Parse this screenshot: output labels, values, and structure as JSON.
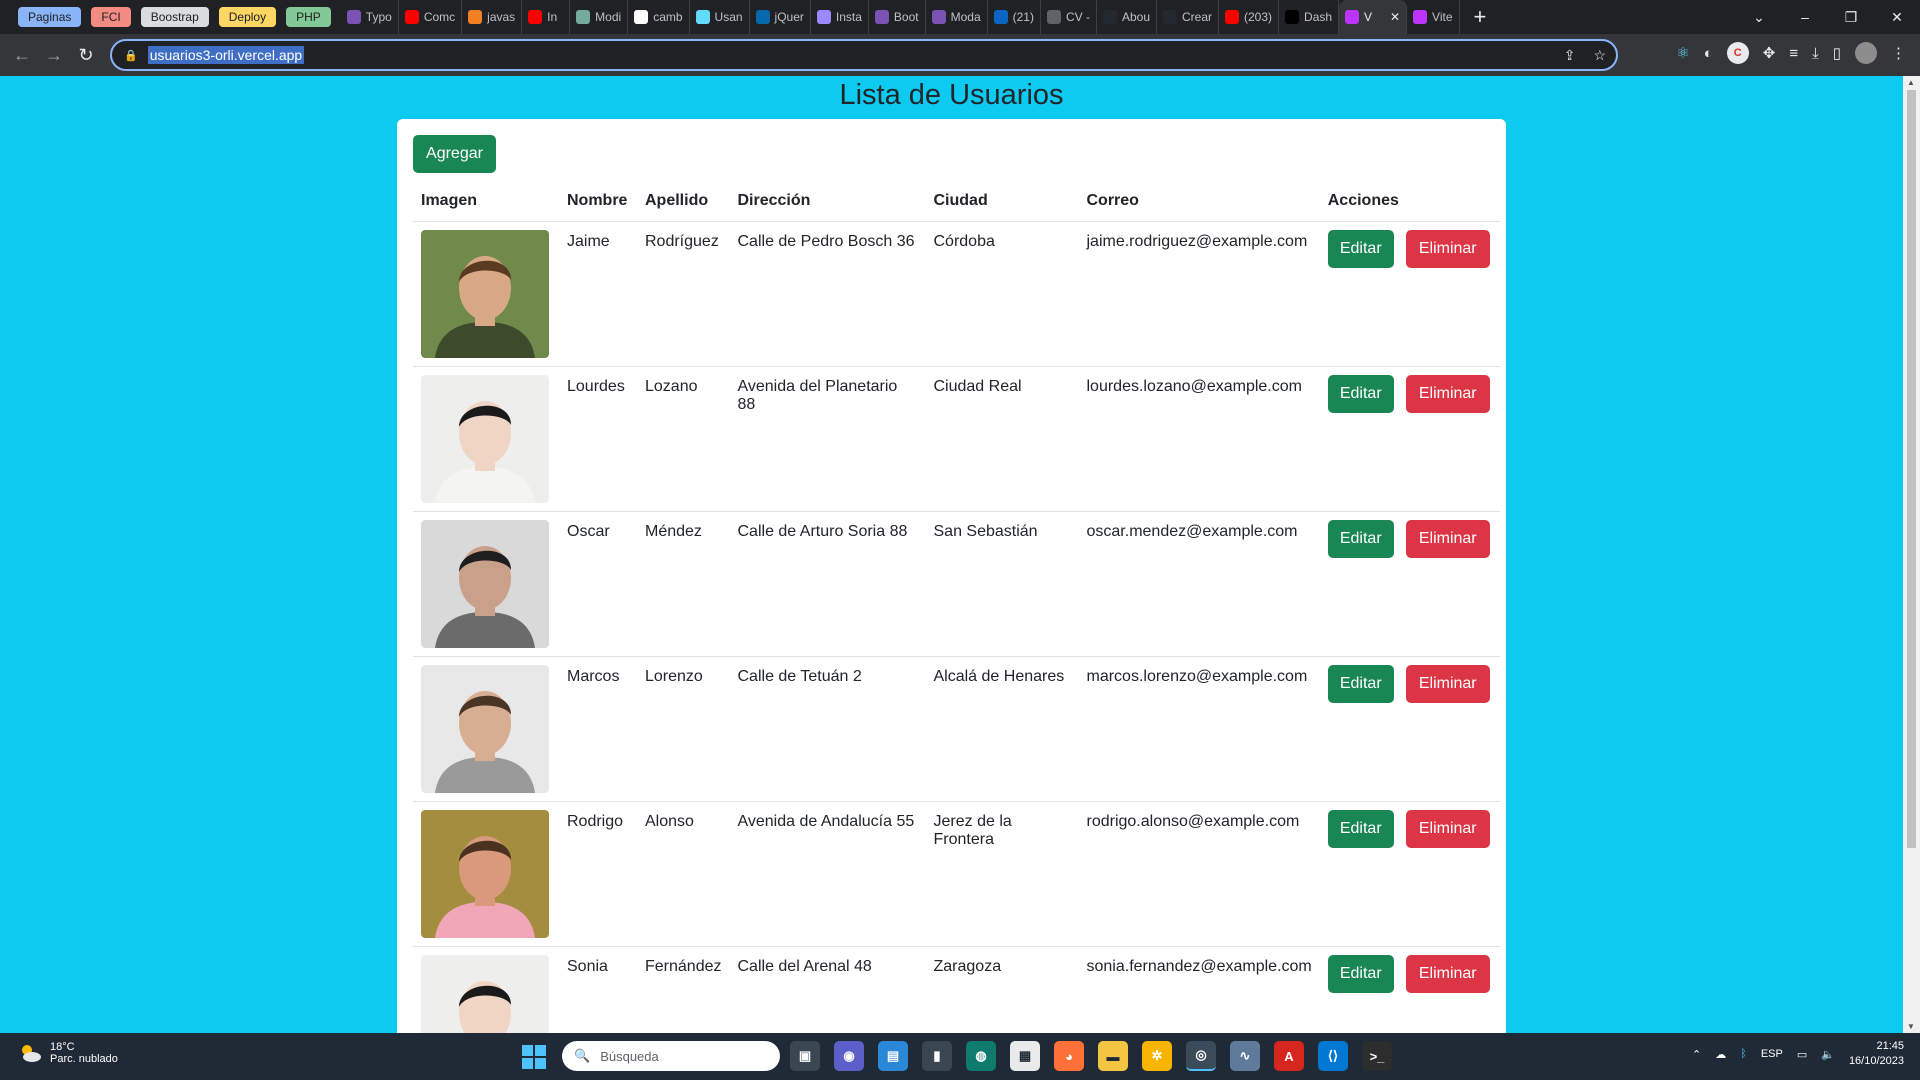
{
  "browser": {
    "bookmark_groups": [
      {
        "label": "Paginas",
        "color": "#8ab4f8"
      },
      {
        "label": "FCI",
        "color": "#f28b82"
      },
      {
        "label": "Boostrap",
        "color": "#dadce0"
      },
      {
        "label": "Deploy",
        "color": "#fdd663"
      },
      {
        "label": "PHP",
        "color": "#81c995"
      }
    ],
    "tabs": [
      {
        "label": "Typo",
        "icon": "bootstrap-icon",
        "color": "#7952b3"
      },
      {
        "label": "Comc",
        "icon": "youtube-icon",
        "color": "#ff0000"
      },
      {
        "label": "javas",
        "icon": "stackoverflow-icon",
        "color": "#f48024"
      },
      {
        "label": "In",
        "icon": "youtube-icon",
        "color": "#ff0000"
      },
      {
        "label": "Modi",
        "icon": "openai-icon",
        "color": "#74aa9c"
      },
      {
        "label": "camb",
        "icon": "google-icon",
        "color": "#ffffff"
      },
      {
        "label": "Usan",
        "icon": "react-icon",
        "color": "#61dafb"
      },
      {
        "label": "jQuer",
        "icon": "jquery-icon",
        "color": "#0769ad"
      },
      {
        "label": "Insta",
        "icon": "instagram-icon",
        "color": "#9c88ff"
      },
      {
        "label": "Boot",
        "icon": "bootstrap-icon",
        "color": "#7952b3"
      },
      {
        "label": "Moda",
        "icon": "bootstrap-icon",
        "color": "#7952b3"
      },
      {
        "label": "(21)",
        "icon": "linkedin-icon",
        "color": "#0a66c2"
      },
      {
        "label": "CV -",
        "icon": "globe-icon",
        "color": "#5f6368"
      },
      {
        "label": "Abou",
        "icon": "github-icon",
        "color": "#24292f"
      },
      {
        "label": "Crear",
        "icon": "github-icon",
        "color": "#24292f"
      },
      {
        "label": "(203)",
        "icon": "youtube-icon",
        "color": "#ff0000"
      },
      {
        "label": "Dash",
        "icon": "vercel-icon",
        "color": "#000000"
      },
      {
        "label": "V",
        "icon": "vite-icon",
        "color": "#bd34fe",
        "active": true
      },
      {
        "label": "Vite",
        "icon": "vite-icon",
        "color": "#bd34fe"
      }
    ],
    "url": "usuarios3-orli.vercel.app"
  },
  "page": {
    "title": "Lista de Usuarios",
    "add_button": "Agregar",
    "columns": [
      "Imagen",
      "Nombre",
      "Apellido",
      "Dirección",
      "Ciudad",
      "Correo",
      "Acciones"
    ],
    "edit_label": "Editar",
    "delete_label": "Eliminar",
    "users": [
      {
        "nombre": "Jaime",
        "apellido": "Rodríguez",
        "direccion": "Calle de Pedro Bosch 36",
        "ciudad": "Córdoba",
        "correo": "jaime.rodriguez@example.com",
        "photo_bg": "#6f8a4a",
        "photo_skin": "#d9a884",
        "photo_hair": "#5a3b22",
        "photo_shirt": "#3d4a2c"
      },
      {
        "nombre": "Lourdes",
        "apellido": "Lozano",
        "direccion": "Avenida del Planetario 88",
        "ciudad": "Ciudad Real",
        "correo": "lourdes.lozano@example.com",
        "photo_bg": "#eeeeec",
        "photo_skin": "#f0d5c4",
        "photo_hair": "#1a1a1a",
        "photo_shirt": "#f4f4f2"
      },
      {
        "nombre": "Oscar",
        "apellido": "Méndez",
        "direccion": "Calle de Arturo Soria 88",
        "ciudad": "San Sebastián",
        "correo": "oscar.mendez@example.com",
        "photo_bg": "#d9d9d9",
        "photo_skin": "#c9a08a",
        "photo_hair": "#1e1e1e",
        "photo_shirt": "#6b6b6b"
      },
      {
        "nombre": "Marcos",
        "apellido": "Lorenzo",
        "direccion": "Calle de Tetuán 2",
        "ciudad": "Alcalá de Henares",
        "correo": "marcos.lorenzo@example.com",
        "photo_bg": "#e8e8e8",
        "photo_skin": "#d8ae92",
        "photo_hair": "#4a3524",
        "photo_shirt": "#9a9a9a"
      },
      {
        "nombre": "Rodrigo",
        "apellido": "Alonso",
        "direccion": "Avenida de Andalucía 55",
        "ciudad": "Jerez de la Frontera",
        "correo": "rodrigo.alonso@example.com",
        "photo_bg": "#a58d3f",
        "photo_skin": "#d99a7c",
        "photo_hair": "#4b3220",
        "photo_shirt": "#f2a7b8"
      },
      {
        "nombre": "Sonia",
        "apellido": "Fernández",
        "direccion": "Calle del Arenal 48",
        "ciudad": "Zaragoza",
        "correo": "sonia.fernandez@example.com",
        "photo_bg": "#eeeeec",
        "photo_skin": "#f0d5c4",
        "photo_hair": "#1a1a1a",
        "photo_shirt": "#f4f4f2"
      }
    ]
  },
  "taskbar": {
    "weather_temp": "18°C",
    "weather_desc": "Parc. nublado",
    "search_placeholder": "Búsqueda",
    "language": "ESP",
    "time": "21:45",
    "date": "16/10/2023"
  }
}
